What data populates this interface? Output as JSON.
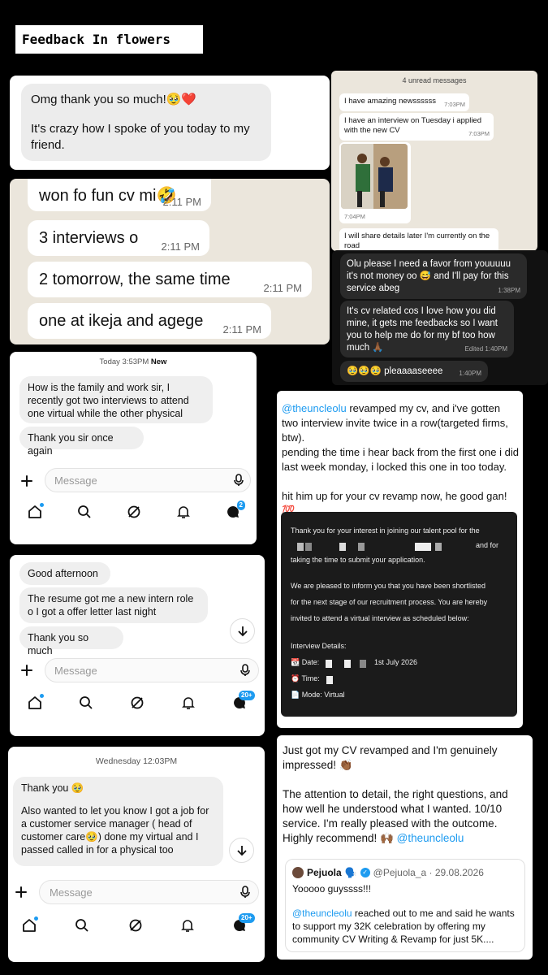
{
  "header": {
    "title": "Feedback In flowers"
  },
  "card1": {
    "line1": "Omg thank you so much!🥹❤️",
    "line2": "It's crazy how I spoke of you today to my friend."
  },
  "card2": {
    "messages": [
      {
        "text": "won fo fun cv mi🤣",
        "time": "2:11 PM"
      },
      {
        "text": "3 interviews o",
        "time": "2:11 PM"
      },
      {
        "text": "2 tomorrow, the same time",
        "time": "2:11 PM"
      },
      {
        "text": "one at ikeja and agege",
        "time": "2:11 PM"
      }
    ]
  },
  "card3": {
    "unread": "4 unread messages",
    "messages": [
      {
        "text": "I have amazing newssssss",
        "time": "7:03PM"
      },
      {
        "text": "I have an interview on Tuesday i applied with the new CV",
        "time": "7:03PM"
      },
      {
        "text": "",
        "time": "7:04PM"
      },
      {
        "text": "I will share details later I'm currently on the road",
        "time": ""
      }
    ]
  },
  "card4": {
    "messages": [
      {
        "text": "Olu  please I need a favor from youuuuu it's not money oo 😅 and I'll pay for this service abeg",
        "time": "1:38PM"
      },
      {
        "text": "It's cv related cos I love how you did mine, it gets me feedbacks so I want you to help me do for my bf too how much 🙏🏾",
        "time": "Edited 1:40PM"
      },
      {
        "text": "🥹🥹🥹 pleaaaaseeee",
        "time": "1:40PM"
      }
    ]
  },
  "card5": {
    "timestamp": "Today 3:53PM",
    "new_label": "New",
    "messages": [
      "How is the family and work sir, I recently got two interviews to attend one virtual while the other physical",
      "Thank you sir once again"
    ],
    "placeholder": "Message",
    "badge": "2"
  },
  "card6": {
    "messages": [
      "Good afternoon",
      "The resume got me a new intern role o I got a offer letter last night",
      "Thank you so much"
    ],
    "placeholder": "Message",
    "badge": "20+"
  },
  "card7": {
    "timestamp": "Wednesday 12:03PM",
    "line1": "Thank you 🥹",
    "line2": "Also wanted to let you know I got a job for a customer service manager ( head of customer care🥹) done my virtual and I passed called in for a physical too",
    "placeholder": "Message",
    "badge": "20+"
  },
  "card8": {
    "mention": "@theuncleolu",
    "p1_rest": " revamped my cv, and i've gotten two interview invite twice in a row(targeted firms, btw).",
    "p2": "pending the time i hear back from the first one i did last week monday, i locked this one in too today.",
    "p3": "hit him up for your cv revamp now, he good gan!💯",
    "letter": {
      "l1": "Thank you for your interest in joining our talent pool for the",
      "l1b": "and for",
      "l2": "taking the time to submit your application.",
      "l3": "We are pleased to inform you that you have been shortlisted",
      "l4": "for the next stage of our recruitment process. You are hereby",
      "l5": "invited to attend a virtual interview as scheduled below:",
      "l6": "Interview Details:",
      "date_label": "📆 Date:",
      "date_value": "1st July 2026",
      "time_label": "⏰ Time:",
      "mode": "📄 Mode: Virtual"
    }
  },
  "card9": {
    "p1": "Just got my CV revamped and I'm genuinely impressed! 👏🏾",
    "p2": "The attention to detail, the right questions, and how well he understood what I wanted. 10/10 service. I'm really pleased with the outcome. Highly recommend! 🙌🏾",
    "p2_mention": "@theuncleolu",
    "quote": {
      "name": "Pejuola",
      "name_emoji": "🗣️",
      "handle": "@Pejuola_a · 29.08.2026",
      "line1": "Yooooo guyssss!!!",
      "mention": "@theuncleolu",
      "rest": " reached out to me and said he wants to support my 32K celebration by offering my community CV Writing & Revamp for just 5K...."
    }
  }
}
